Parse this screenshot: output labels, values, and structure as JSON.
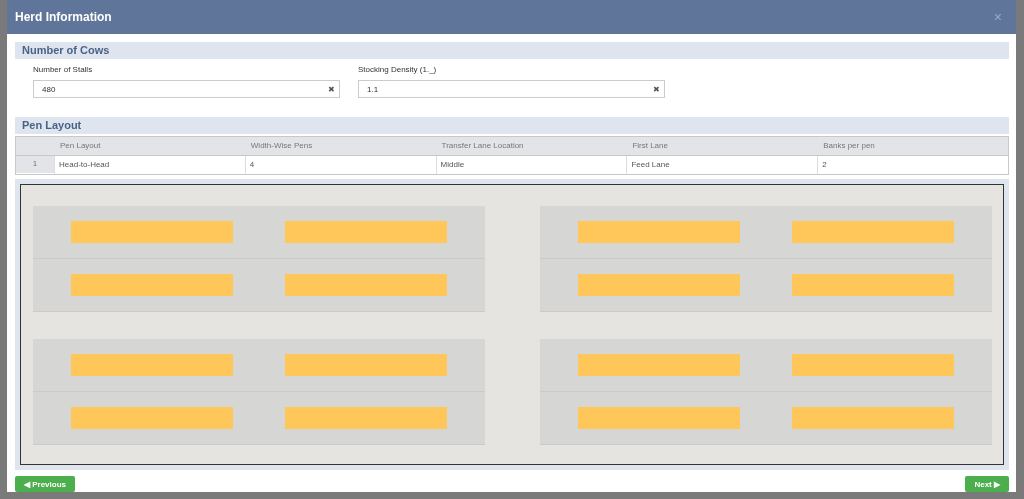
{
  "window": {
    "title": "Herd Information",
    "close": "×"
  },
  "cows": {
    "title": "Number of Cows",
    "fields": [
      {
        "label": "Number of Stalls",
        "value": "480",
        "clear": "✖"
      },
      {
        "label": "Stocking Density (1._)",
        "value": "1.1",
        "clear": "✖"
      }
    ]
  },
  "pen_layout": {
    "title": "Pen Layout",
    "columns": [
      "Pen Layout",
      "Width-Wise Pens",
      "Transfer Lane Location",
      "First Lane",
      "Banks per pen"
    ],
    "rows": [
      {
        "index": "1",
        "cells": [
          "Head-to-Head",
          "4",
          "Middle",
          "Feed Lane",
          "2"
        ]
      }
    ]
  },
  "buttons": {
    "previous": "◀ Previous",
    "next": "Next ▶"
  }
}
